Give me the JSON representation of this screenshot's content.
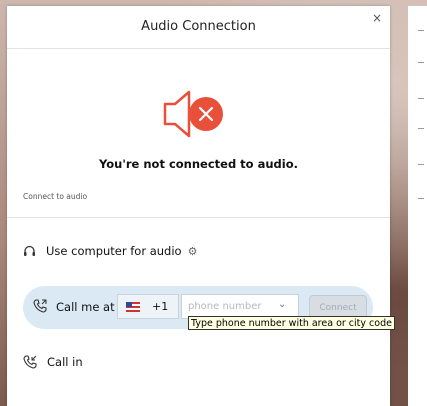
{
  "dialog": {
    "title": "Audio Connection",
    "close_glyph": "×"
  },
  "status": {
    "message": "You're not connected to audio.",
    "section_label": "Connect to audio",
    "icon": "speaker-muted-icon",
    "icon_color": "#e8503a"
  },
  "options": {
    "computer": {
      "label": "Use computer for audio",
      "icon": "headset-icon",
      "gear_icon": "gear-icon"
    },
    "call_me": {
      "label": "Call me at",
      "country_code": "+1",
      "country_flag": "us-flag-icon",
      "phone_placeholder": "phone number",
      "connect_label": "Connect",
      "highlight_color": "#dbe9f5"
    },
    "call_in": {
      "label": "Call in",
      "icon": "phone-in-icon"
    }
  },
  "tooltip": {
    "text": "Type phone number with area or city code"
  }
}
